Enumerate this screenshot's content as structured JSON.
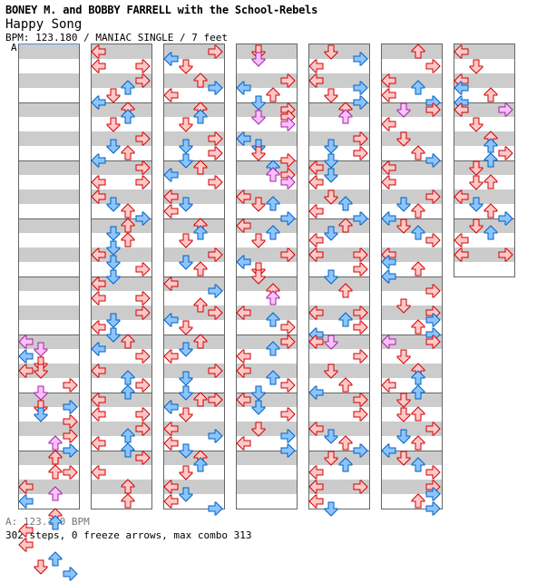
{
  "header": {
    "artist": "BONEY M. and BOBBY FARRELL with the School-Rebels",
    "title": "Happy Song",
    "info": "BPM: 123.180 / MANIAC SINGLE / 7 feet",
    "bpm_marker": "A"
  },
  "footer": {
    "bpm_legend": "A: 123.180 BPM",
    "summary": "302 steps, 0 freeze arrows, max combo 313"
  },
  "colors": {
    "quarter_fill": "#ffc8c8",
    "quarter_stroke": "#d00000",
    "eighth_fill": "#8cc4ff",
    "eighth_stroke": "#0060c0",
    "sixteenth_fill": "#ffc0ff",
    "sixteenth_stroke": "#a020a0",
    "stripe": "#cccccc",
    "border": "#666666",
    "bpm_line": "#4a90d9"
  },
  "chart": {
    "lanes": [
      "left",
      "down",
      "up",
      "right"
    ],
    "measures_per_column": 8,
    "columns": [
      {
        "measures": 8,
        "notes": "L40p D41p L42b D43r L44r D44r R46r D47p D49r R49b D50b R51r R53r U54p R55b U56r U58r R58r L60r U61p L62b U64r U65b L66r L68r U70b D71r R72b"
      },
      {
        "measures": 8,
        "notes": "L0r L2r R2r R4r U5b D6r L7b U8r U9b D10r R12r D13b U14r L15b R16r L18r R18r L20r D21b U22r R23b U24r D25b U26r D27b L28r D29b R30r D31b L32r L34r R34r R36r D37b L38r D39b U40r L41b R42r L44r U45b R46r U47b L48r L50r R50r R52r U53b L54r U55b R56r L58r U60r U62r"
      },
      {
        "measures": 8,
        "notes": "R0r L1b D2r U4r R5b L6r U8r U9b D10r R12r D13b R14r D15b U16r L17b R18r L20r D21b L22r U24r U25b D26r R28r D29b U30r L32r R33b U35r R36r L37b D38r U40r D41b L42r R44r D45b D47b U48r R48r L49b D50r L52r R53b L54r D55b U56r U57b D58r L60r D61b L62r R63b"
      },
      {
        "measures": 8,
        "notes": "D0r D1p R4r L5b U6r D7b R8r D9p R9r R10p L12b D13b D14r R15r U16b U17p R17r R18p L20r D21r U21b R23b L24r U25b D26r R28r L29b D30r D31r U33r U34p L36r U37b R38r R40r U41b L42r L44r U45b R46r D47b L48r D49b R50r D52r R53b L54r R55b"
      },
      {
        "measures": 8,
        "notes": "D0r R1b L2r L4r R5b D6r R7b U8r U9p R12r R14r D13b D15b L16r D17b L18r D20r U21b L22r R23b U24r D25b L26r L28r R28r R30r D31b U33r L36r U37b R36r R38r L39b D40p L40r R42r D44r U46r L47b R48r R50r L52r D53b U54r R55b D56r U57b L58r L60r R60r L62r D63b"
      },
      {
        "measures": 8,
        "notes": "U0r R2r L4r U5b L6r R7b D8p R8r L10r D12r U14r R15b L16r L18r R20r D21b U22r L23b D24r U25b R26r L28r L29b U30r L31b R33r D35r R36r R37b U38r R39b L40p R40r D42r U44r U45b L46r U47b D48r D50r U50r R52r D53b U54r L55b D56r U57b R58r R60r R61b U62r R63b"
      },
      {
        "measures": 4,
        "notes": "L0r D2r L4r L5b U6r L7b L8r R8p D10r U12r U13b R14r U15b D16r D18r U18r L20r D21b U22r R23b D24r U25b L26r L28r R28r"
      }
    ]
  }
}
